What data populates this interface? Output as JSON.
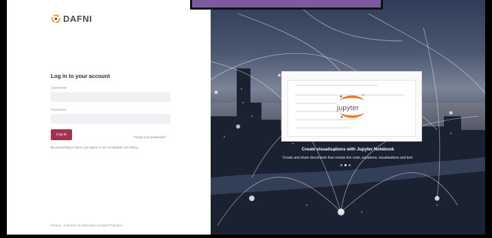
{
  "brand": {
    "name": "DAFNI"
  },
  "login": {
    "title": "Log in to your account",
    "username_label": "Username",
    "password_label": "Password",
    "username_value": "",
    "password_value": "",
    "login_button": "Log in",
    "forgot_link": "Forgot your password?",
    "policy_prefix": "By proceeding to log in, you agree to our",
    "policy_link": "Acceptable Use Policy",
    "policy_suffix": "."
  },
  "footer": {
    "text": "Privacy · Freedom of Information & Data Protection"
  },
  "hero": {
    "card_logo_text": "jupyter",
    "caption_title": "Create visualisations with Jupyter Notebook",
    "caption_subtitle": "Create and share documents that contain live code, equations, visualisations and text.",
    "slides": 3,
    "active_slide": 1
  },
  "colors": {
    "accent": "#a3324f",
    "link": "#6b7fa8",
    "jupyter_orange": "#f37726",
    "top_tab": "#7b5a9e"
  }
}
